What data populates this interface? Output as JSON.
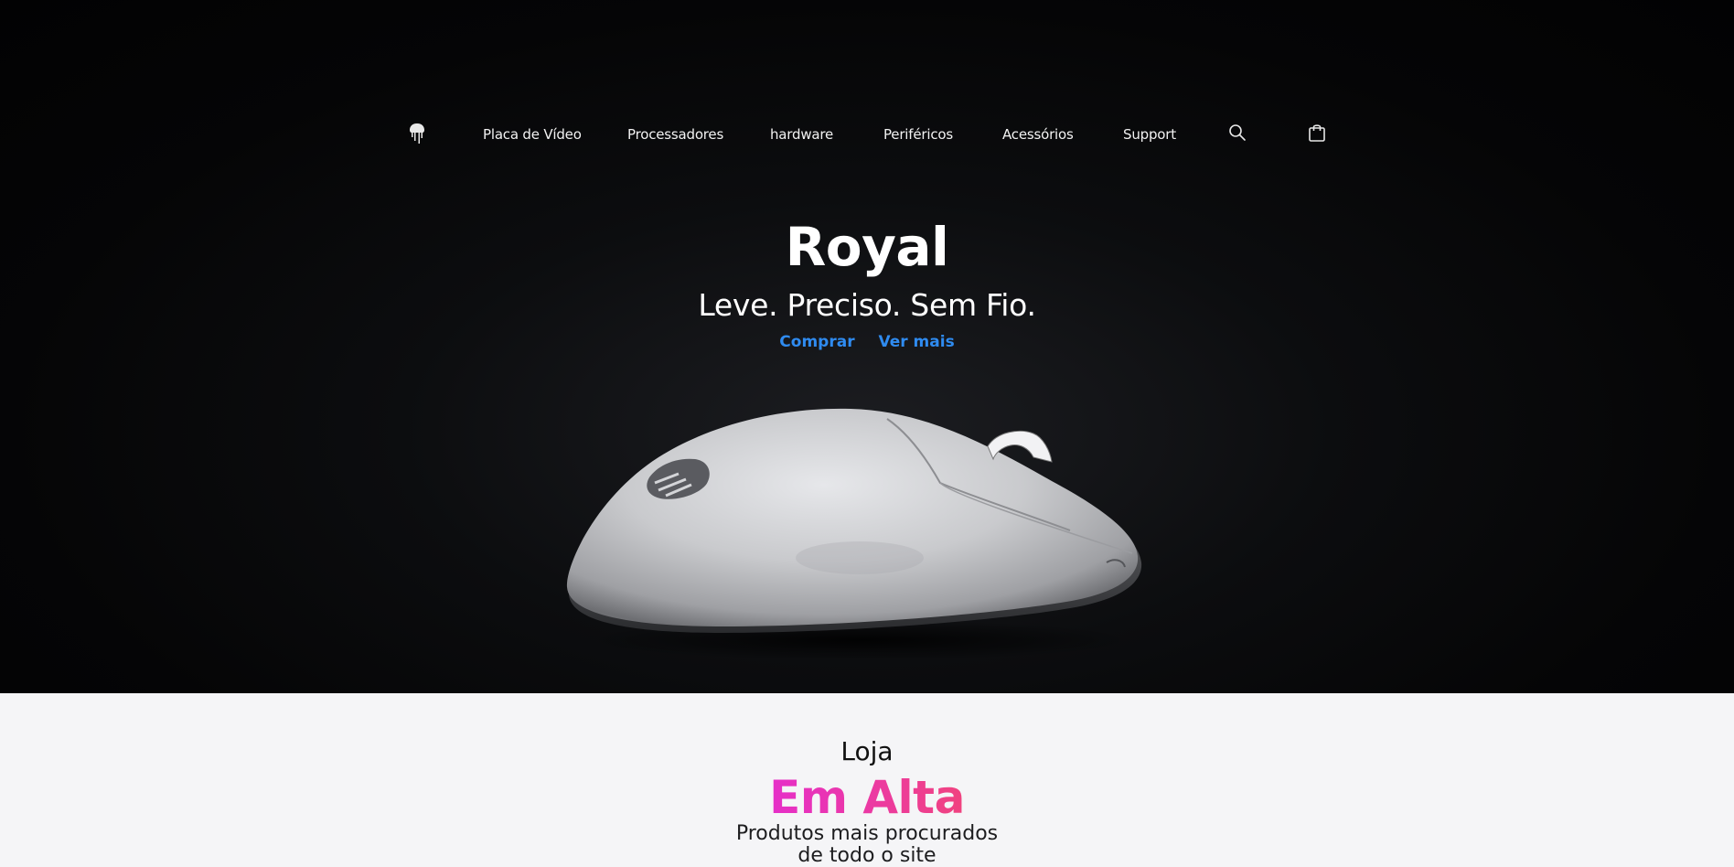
{
  "nav": {
    "logo": "logo-icon",
    "links": [
      {
        "label": "Placa de Vídeo"
      },
      {
        "label": "Processadores"
      },
      {
        "label": "hardware"
      },
      {
        "label": "Periféricos"
      },
      {
        "label": "Acessórios"
      },
      {
        "label": "Support"
      }
    ],
    "search_icon": "search-icon",
    "bag_icon": "shopping-bag-icon"
  },
  "hero": {
    "title": "Royal",
    "subtitle": "Leve. Preciso. Sem Fio.",
    "cta_primary": "Comprar",
    "cta_secondary": "Ver mais",
    "product_image": "white-wireless-mouse",
    "link_color": "#2f8bf0",
    "background_color": "#050506"
  },
  "section": {
    "kicker": "Loja",
    "title": "Em Alta",
    "description_line1": "Produtos mais procurados",
    "description_line2": "de todo o site",
    "title_gradient": [
      "#e62fc9",
      "#f0437f"
    ],
    "background_color": "#f5f5f7"
  }
}
